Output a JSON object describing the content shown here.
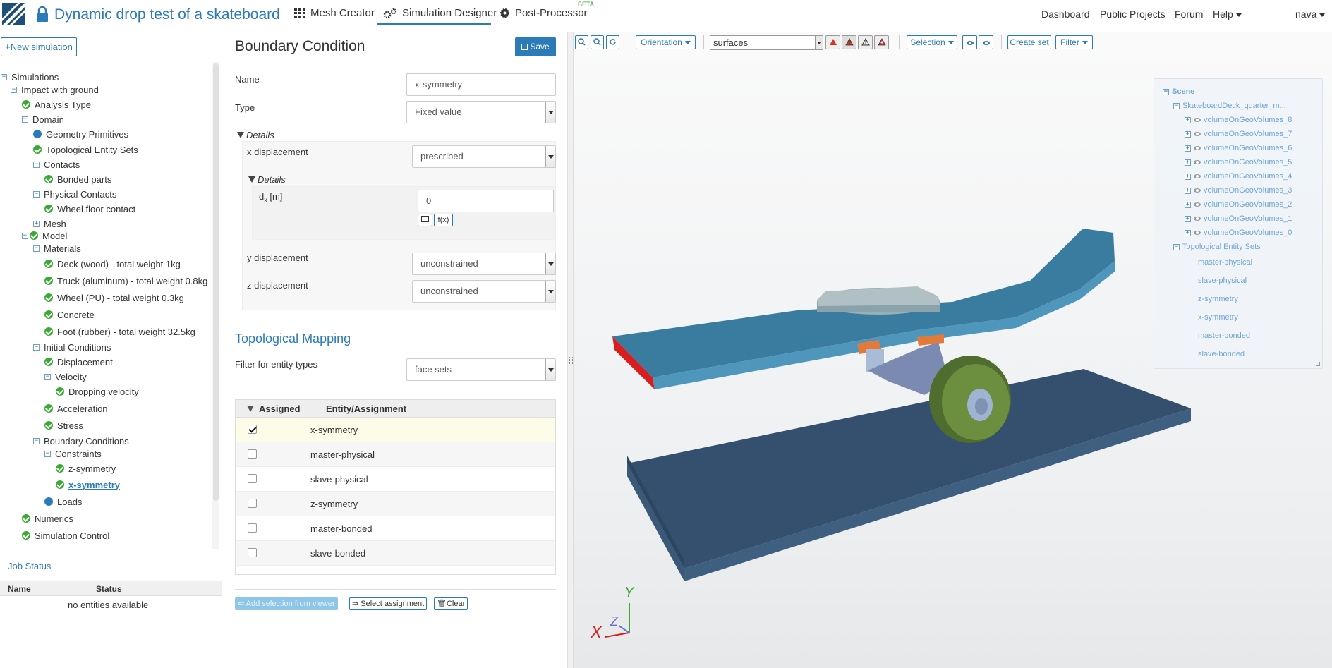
{
  "header": {
    "title": "Dynamic drop test of a skateboard",
    "nav": [
      "Mesh Creator",
      "Simulation Designer",
      "Post-Processor"
    ],
    "beta": "BETA",
    "right_nav": [
      "Dashboard",
      "Public Projects",
      "Forum",
      "Help"
    ],
    "user": "nava"
  },
  "left": {
    "new_simulation": "New simulation",
    "tree": {
      "simulations": "Simulations",
      "impact": "Impact with ground",
      "analysis_type": "Analysis Type",
      "domain": "Domain",
      "geometry_primitives": "Geometry Primitives",
      "topological_entity_sets": "Topological Entity Sets",
      "contacts": "Contacts",
      "bonded_parts": "Bonded parts",
      "physical_contacts": "Physical Contacts",
      "wheel_floor_contact": "Wheel floor contact",
      "mesh": "Mesh",
      "model": "Model",
      "materials": "Materials",
      "mat_deck": "Deck (wood) - total weight 1kg",
      "mat_truck": "Truck (aluminum) - total weight 0.8kg",
      "mat_wheel": "Wheel (PU) - total weight 0.3kg",
      "mat_concrete": "Concrete",
      "mat_foot": "Foot (rubber) - total weight 32.5kg",
      "initial_conditions": "Initial Conditions",
      "displacement": "Displacement",
      "velocity": "Velocity",
      "dropping_velocity": "Dropping velocity",
      "acceleration": "Acceleration",
      "stress": "Stress",
      "boundary_conditions": "Boundary Conditions",
      "constraints": "Constraints",
      "z_symmetry": "z-symmetry",
      "x_symmetry": "x-symmetry",
      "loads": "Loads",
      "numerics": "Numerics",
      "simulation_control": "Simulation Control"
    },
    "job_status": {
      "title": "Job Status",
      "col_name": "Name",
      "col_status": "Status",
      "empty": "no entities available"
    }
  },
  "form": {
    "title": "Boundary Condition",
    "save": "Save",
    "name_label": "Name",
    "name_value": "x-symmetry",
    "type_label": "Type",
    "type_value": "Fixed value",
    "details": "Details",
    "x_disp_label": "x displacement",
    "x_disp_value": "prescribed",
    "inner_details": "Details",
    "dx_label_main": "d",
    "dx_label_sub": "x",
    "dx_label_unit": " [m]",
    "dx_value": "0",
    "fx_button": "f(x)",
    "y_disp_label": "y displacement",
    "y_disp_value": "unconstrained",
    "z_disp_label": "z displacement",
    "z_disp_value": "unconstrained",
    "topo_title": "Topological Mapping",
    "filter_label": "Filter for entity types",
    "filter_value": "face sets",
    "table": {
      "col_assigned": "Assigned",
      "col_entity": "Entity/Assignment",
      "rows": [
        {
          "label": "x-symmetry",
          "checked": true
        },
        {
          "label": "master-physical",
          "checked": false
        },
        {
          "label": "slave-physical",
          "checked": false
        },
        {
          "label": "z-symmetry",
          "checked": false
        },
        {
          "label": "master-bonded",
          "checked": false
        },
        {
          "label": "slave-bonded",
          "checked": false
        }
      ]
    },
    "add_selection": "Add selection from viewer",
    "select_assignment": "Select assignment",
    "clear": "Clear"
  },
  "viewer": {
    "orientation": "Orientation",
    "render_mode": "surfaces",
    "selection": "Selection",
    "create_set": "Create set",
    "filter": "Filter",
    "scene": {
      "root": "Scene",
      "model": "SkateboardDeck_quarter_m...",
      "volumes": [
        "volumeOnGeoVolumes_8",
        "volumeOnGeoVolumes_7",
        "volumeOnGeoVolumes_6",
        "volumeOnGeoVolumes_5",
        "volumeOnGeoVolumes_4",
        "volumeOnGeoVolumes_3",
        "volumeOnGeoVolumes_2",
        "volumeOnGeoVolumes_1",
        "volumeOnGeoVolumes_0"
      ],
      "topo_sets_label": "Topological Entity Sets",
      "topo_sets": [
        "master-physical",
        "slave-physical",
        "z-symmetry",
        "x-symmetry",
        "master-bonded",
        "slave-bonded"
      ]
    },
    "axes": {
      "x": "X",
      "y": "Y",
      "z": "Z"
    },
    "colors": {
      "accent": "#2b7bb9",
      "success": "#3aaa35",
      "deck": "#3a7a9c",
      "floor": "#34506e",
      "wheel": "#5a7a3a"
    }
  }
}
